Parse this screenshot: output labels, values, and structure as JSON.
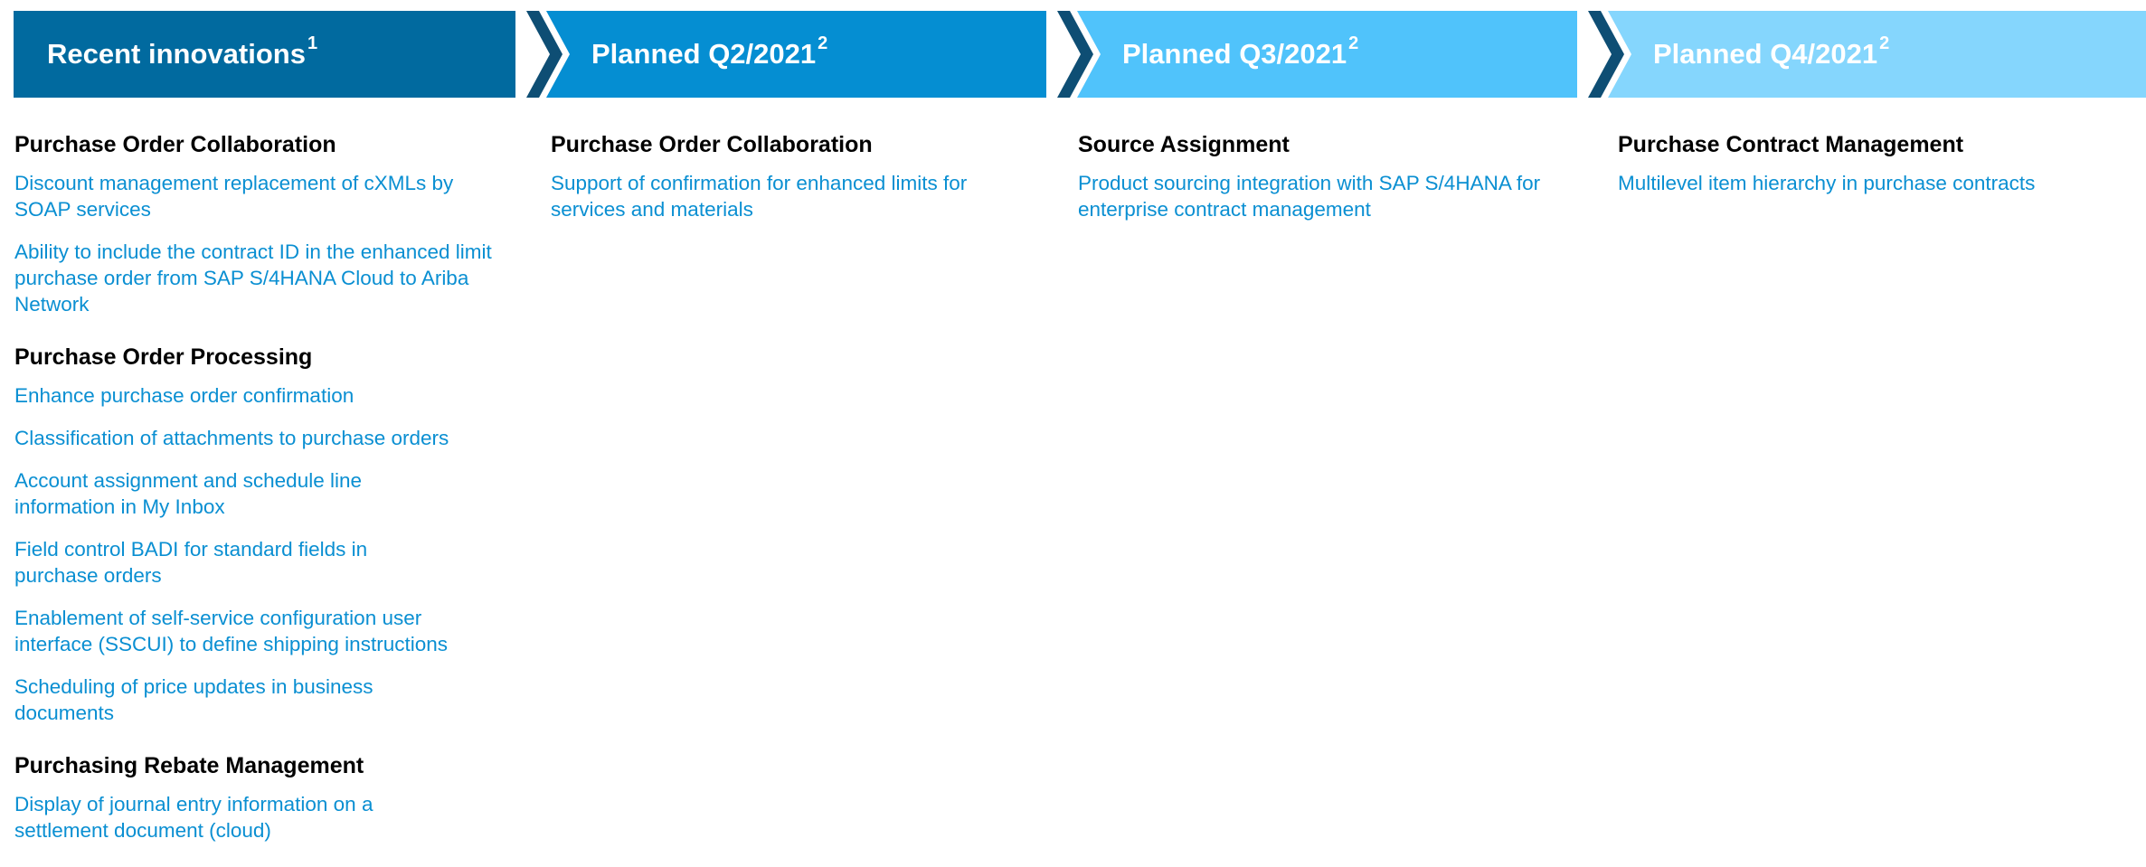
{
  "colors": {
    "header_1": "#016a9f",
    "header_2": "#058ed2",
    "header_3": "#50c3fb",
    "header_4": "#85d6fd",
    "chevron_dark": "#0e4e74",
    "section_title": "#000000",
    "item_text": "#0a8fd2"
  },
  "headers": [
    {
      "label": "Recent innovations",
      "sup": "1"
    },
    {
      "label": "Planned Q2/2021",
      "sup": "2"
    },
    {
      "label": "Planned Q3/2021",
      "sup": "2"
    },
    {
      "label": "Planned Q4/2021",
      "sup": "2"
    }
  ],
  "columns": [
    {
      "sections": [
        {
          "title": "Purchase Order Collaboration",
          "items": [
            "Discount management replacement of cXMLs by SOAP services",
            "Ability to include the contract ID in the enhanced limit purchase order from SAP S/4HANA Cloud to Ariba Network"
          ]
        },
        {
          "title": "Purchase Order Processing",
          "items": [
            "Enhance purchase order confirmation",
            "Classification of attachments to purchase orders",
            "Account assignment and schedule line information in My Inbox",
            "Field control BADI for standard fields in purchase orders",
            "Enablement of self-service configuration user interface (SSCUI) to define shipping instructions",
            "Scheduling of price updates in business documents"
          ]
        },
        {
          "title": "Purchasing Rebate Management",
          "items": [
            "Display of journal entry information on a settlement document (cloud)"
          ]
        }
      ]
    },
    {
      "sections": [
        {
          "title": "Purchase Order Collaboration",
          "items": [
            "Support of confirmation for enhanced limits for services and materials"
          ]
        }
      ]
    },
    {
      "sections": [
        {
          "title": "Source Assignment",
          "items": [
            "Product sourcing integration with SAP S/4HANA for enterprise contract management"
          ]
        }
      ]
    },
    {
      "sections": [
        {
          "title": "Purchase Contract Management",
          "items": [
            "Multilevel item hierarchy in purchase contracts"
          ]
        }
      ]
    }
  ]
}
